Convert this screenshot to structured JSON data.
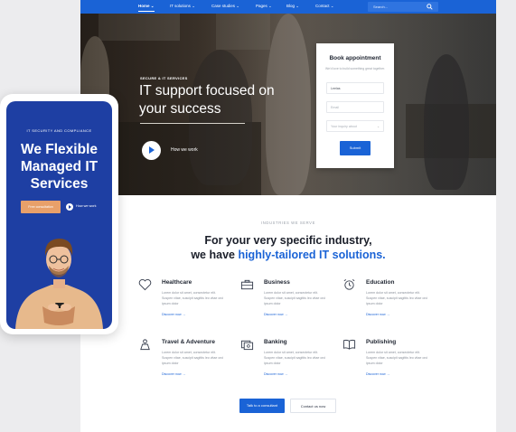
{
  "nav": {
    "items": [
      {
        "label": "Home",
        "chevron": "⌄"
      },
      {
        "label": "IT solutions",
        "chevron": "⌄"
      },
      {
        "label": "Case studies",
        "chevron": "⌄"
      },
      {
        "label": "Pages",
        "chevron": "⌄"
      },
      {
        "label": "Blog",
        "chevron": "⌄"
      },
      {
        "label": "Contact",
        "chevron": "⌄"
      }
    ],
    "search_placeholder": "Search..."
  },
  "hero": {
    "eyebrow": "SECURE & IT SERVICES",
    "title": "IT support focused on your success",
    "video_label": "How we work"
  },
  "booking": {
    "title": "Book appointment",
    "subtitle": "We'd love to build something great together.",
    "name_value": "Leelas",
    "email_placeholder": "Email",
    "inquiry_placeholder": "Your inquiry about",
    "inquiry_caret": "⌄",
    "submit_label": "Submit"
  },
  "industries": {
    "eyebrow": "INDUSTRIES WE SERVE",
    "heading_line1": "For your very specific industry,",
    "heading_prefix": "we have",
    "heading_highlight": "highly-tailored IT solutions.",
    "description": "Lorem dolor sit amet, consectetur elit. Suspen vitae, suscipit sagittis leo vitae orci ipsum dolor",
    "link_label": "Discover now →",
    "items": [
      {
        "name": "Healthcare",
        "icon": "heart-icon"
      },
      {
        "name": "Business",
        "icon": "briefcase-icon"
      },
      {
        "name": "Education",
        "icon": "alarm-clock-icon"
      },
      {
        "name": "Travel & Adventure",
        "icon": "traveler-icon"
      },
      {
        "name": "Banking",
        "icon": "bank-note-icon"
      },
      {
        "name": "Publishing",
        "icon": "book-icon"
      }
    ]
  },
  "cta": {
    "primary_label": "Talk to a consultant",
    "secondary_label": "Contact us now"
  },
  "mobile": {
    "eyebrow": "IT SECURITY AND COMPLIANCE",
    "title": "We Flexible Managed IT Services",
    "cta_label": "Free consultation",
    "video_label": "How we work"
  },
  "colors": {
    "accent": "#1a63d6",
    "mobile_bg": "#1e3fa3",
    "cta_orange": "#e8a06a"
  }
}
